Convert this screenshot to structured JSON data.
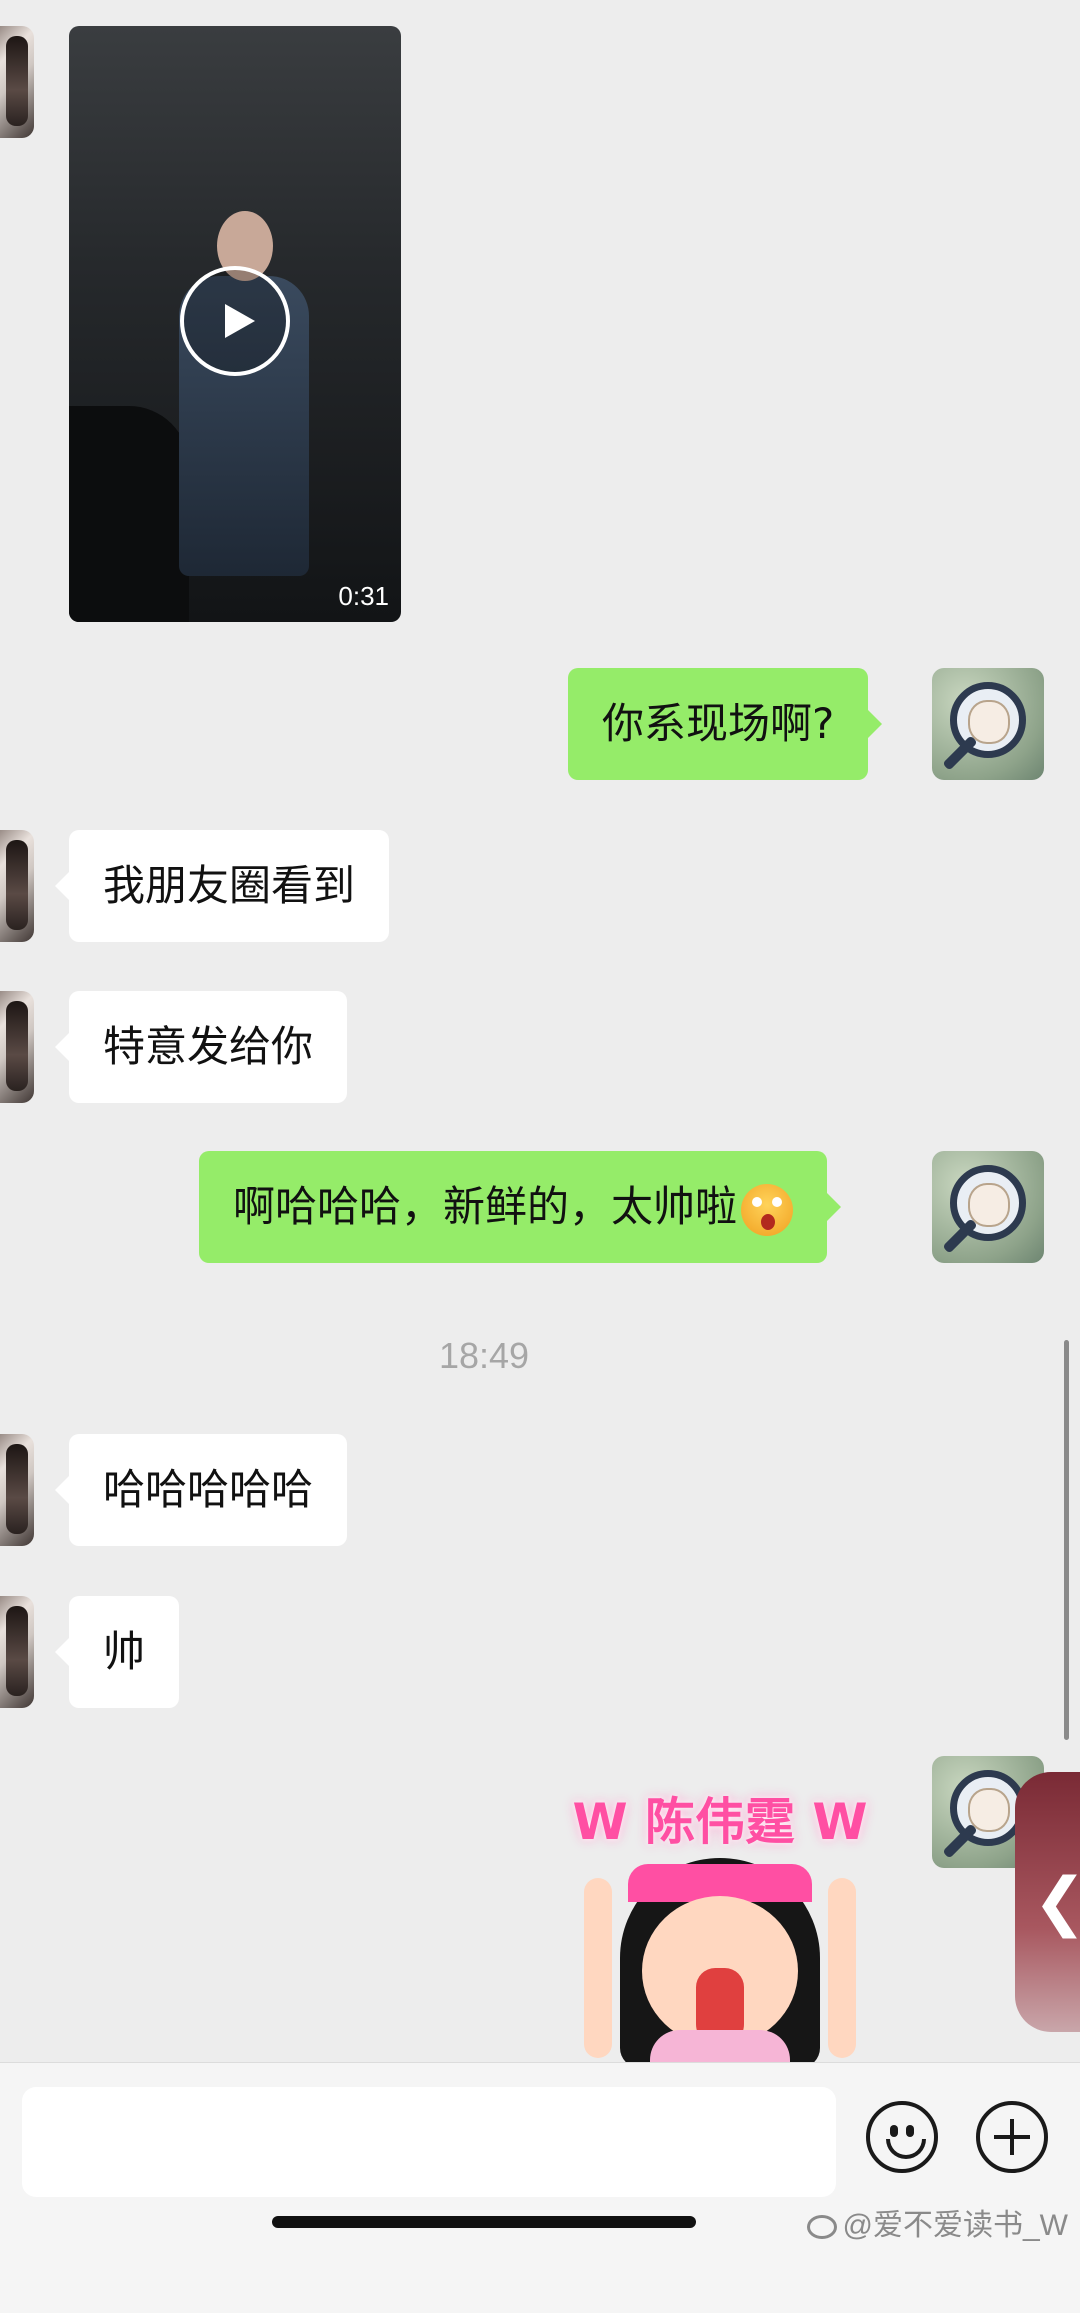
{
  "messages": {
    "video_duration": "0:31",
    "m1": "你系现场啊?",
    "m2": "我朋友圈看到",
    "m3": "特意发给你",
    "m4": "啊哈哈哈，新鲜的，太帅啦",
    "m5": "哈哈哈哈哈",
    "m6": "帅"
  },
  "timestamp": "18:49",
  "sticker": {
    "banner": "W 陈伟霆 W"
  },
  "icons": {
    "emoji_button": "smiley-face-icon",
    "more_button": "plus-circle-icon",
    "side_handle": "chevron-left-icon",
    "video_play": "play-icon"
  },
  "colors": {
    "outgoing_bubble": "#95ec69",
    "incoming_bubble": "#ffffff",
    "background": "#ededed"
  },
  "input": {
    "value": "",
    "placeholder": ""
  },
  "watermark": "@爱不爱读书_W"
}
